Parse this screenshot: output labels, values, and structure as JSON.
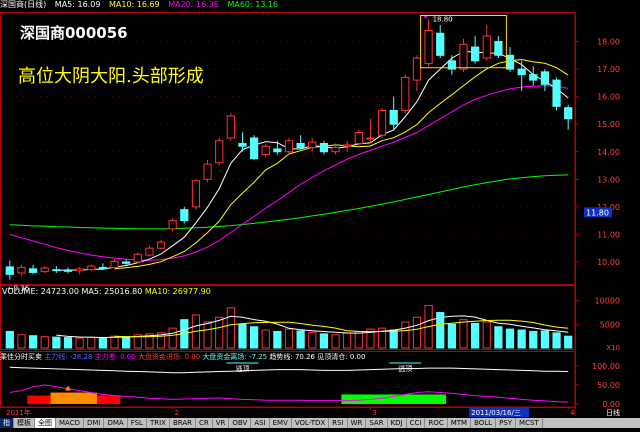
{
  "header": {
    "title": "深国商(日线)",
    "ma": [
      {
        "label": "MA5: 16.09",
        "color": "#ffffff"
      },
      {
        "label": "MA10: 16.69",
        "color": "#ffff00"
      },
      {
        "label": "MA20: 16.36",
        "color": "#ff00ff"
      },
      {
        "label": "MA60: 13.16",
        "color": "#00ff00"
      }
    ]
  },
  "stock_label": "深国商000056",
  "annotation": "高位大阴大阳.头部形成",
  "colors": {
    "up": "#ff3232",
    "down": "#54ffff",
    "ma5": "#ffffff",
    "ma10": "#ffff00",
    "ma20": "#ff00ff",
    "ma60": "#00ff00",
    "axis": "#b40000",
    "annotation": "#ffff00"
  },
  "price_axis": {
    "ticks": [
      "18.00",
      "17.00",
      "16.00",
      "15.00",
      "14.00",
      "13.00",
      "12.00",
      "11.00",
      "10.00"
    ],
    "last": "11.80"
  },
  "price_markers": {
    "high": "18.80",
    "low": "9.36"
  },
  "volume_header": {
    "label": "VOLUME: 24723.00",
    "ma5": "MA5: 25016.80",
    "ma10": "MA10: 26977.90"
  },
  "volume_axis": {
    "ticks": [
      "10000",
      "5000"
    ],
    "unit": "X10"
  },
  "indicator_header": {
    "title": "乘佳分时买卖",
    "items": [
      {
        "label": "主力线:  -28.28",
        "color": "#4a6bff"
      },
      {
        "label": "主力差: 0.00",
        "color": "#ff00ff"
      },
      {
        "label": "大盘资金进场: 0.00",
        "color": "#ff3232"
      },
      {
        "label": "大盘资金离场: -7.25",
        "color": "#54ffff"
      },
      {
        "label": "趋势线: 70.26",
        "color": "#ffffff"
      },
      {
        "label": "见顶清仓: 0.00",
        "color": "#ffffff"
      }
    ]
  },
  "indicator_axis": {
    "ticks": [
      "100.00",
      "50.00",
      "0.00"
    ]
  },
  "indicator_notes": [
    "逃顶",
    "逃顶"
  ],
  "x_axis": {
    "labels": [
      "2011年",
      "2",
      "3",
      "4"
    ],
    "date_box": "2011/03/16/三",
    "right": "日线"
  },
  "tabs": [
    "指",
    "模板",
    "全图",
    "MACD",
    "DMI",
    "DMA",
    "FSL",
    "TRIX",
    "BRAR",
    "CR",
    "VR",
    "OBV",
    "ASI",
    "EMV",
    "VOL-TDX",
    "RSI",
    "WR",
    "SAR",
    "KDJ",
    "CCI",
    "ROC",
    "MTM",
    "BOLL",
    "PSY",
    "MCST"
  ],
  "chart_data": {
    "type": "candlestick",
    "ylim": [
      9.2,
      19.0
    ],
    "candles": [
      {
        "o": 9.82,
        "h": 10.05,
        "l": 9.36,
        "c": 9.55
      },
      {
        "o": 9.6,
        "h": 9.9,
        "l": 9.5,
        "c": 9.8
      },
      {
        "o": 9.75,
        "h": 9.9,
        "l": 9.55,
        "c": 9.62
      },
      {
        "o": 9.65,
        "h": 9.85,
        "l": 9.6,
        "c": 9.78
      },
      {
        "o": 9.72,
        "h": 9.85,
        "l": 9.6,
        "c": 9.7
      },
      {
        "o": 9.7,
        "h": 9.8,
        "l": 9.58,
        "c": 9.66
      },
      {
        "o": 9.68,
        "h": 9.82,
        "l": 9.55,
        "c": 9.75
      },
      {
        "o": 9.72,
        "h": 9.9,
        "l": 9.65,
        "c": 9.85
      },
      {
        "o": 9.8,
        "h": 9.95,
        "l": 9.7,
        "c": 9.76
      },
      {
        "o": 9.8,
        "h": 10.1,
        "l": 9.72,
        "c": 10.02
      },
      {
        "o": 10.0,
        "h": 10.1,
        "l": 9.9,
        "c": 9.95
      },
      {
        "o": 10.0,
        "h": 10.35,
        "l": 9.95,
        "c": 10.28
      },
      {
        "o": 10.25,
        "h": 10.6,
        "l": 10.2,
        "c": 10.5
      },
      {
        "o": 10.5,
        "h": 10.8,
        "l": 10.45,
        "c": 10.72
      },
      {
        "o": 11.2,
        "h": 11.6,
        "l": 11.1,
        "c": 11.5
      },
      {
        "o": 11.9,
        "h": 12.0,
        "l": 11.4,
        "c": 11.5
      },
      {
        "o": 12.0,
        "h": 13.0,
        "l": 11.9,
        "c": 12.95
      },
      {
        "o": 13.0,
        "h": 13.7,
        "l": 12.9,
        "c": 13.55
      },
      {
        "o": 13.6,
        "h": 14.5,
        "l": 13.5,
        "c": 14.4
      },
      {
        "o": 14.5,
        "h": 15.4,
        "l": 14.4,
        "c": 15.3
      },
      {
        "o": 14.3,
        "h": 14.7,
        "l": 14.0,
        "c": 14.2
      },
      {
        "o": 14.5,
        "h": 14.6,
        "l": 13.7,
        "c": 13.75
      },
      {
        "o": 13.9,
        "h": 14.3,
        "l": 13.8,
        "c": 14.2
      },
      {
        "o": 14.1,
        "h": 14.4,
        "l": 13.9,
        "c": 14.0
      },
      {
        "o": 14.0,
        "h": 14.5,
        "l": 13.9,
        "c": 14.4
      },
      {
        "o": 14.3,
        "h": 14.6,
        "l": 14.1,
        "c": 14.15
      },
      {
        "o": 14.15,
        "h": 14.5,
        "l": 14.0,
        "c": 14.35
      },
      {
        "o": 14.3,
        "h": 14.4,
        "l": 13.9,
        "c": 14.0
      },
      {
        "o": 14.0,
        "h": 14.3,
        "l": 13.9,
        "c": 14.15
      },
      {
        "o": 14.2,
        "h": 14.4,
        "l": 14.0,
        "c": 14.25
      },
      {
        "o": 14.3,
        "h": 14.8,
        "l": 14.2,
        "c": 14.7
      },
      {
        "o": 14.5,
        "h": 15.2,
        "l": 14.3,
        "c": 14.5
      },
      {
        "o": 14.6,
        "h": 15.6,
        "l": 14.5,
        "c": 15.5
      },
      {
        "o": 15.5,
        "h": 16.0,
        "l": 14.8,
        "c": 15.0
      },
      {
        "o": 15.5,
        "h": 16.8,
        "l": 15.4,
        "c": 16.7
      },
      {
        "o": 16.6,
        "h": 17.5,
        "l": 16.2,
        "c": 17.4
      },
      {
        "o": 17.2,
        "h": 18.8,
        "l": 17.1,
        "c": 18.4
      },
      {
        "o": 18.3,
        "h": 18.6,
        "l": 17.4,
        "c": 17.5
      },
      {
        "o": 17.3,
        "h": 17.5,
        "l": 16.8,
        "c": 17.0
      },
      {
        "o": 17.0,
        "h": 18.1,
        "l": 16.9,
        "c": 17.9
      },
      {
        "o": 17.8,
        "h": 18.2,
        "l": 17.2,
        "c": 17.3
      },
      {
        "o": 17.4,
        "h": 18.6,
        "l": 17.3,
        "c": 18.2
      },
      {
        "o": 18.0,
        "h": 18.2,
        "l": 17.4,
        "c": 17.5
      },
      {
        "o": 17.5,
        "h": 17.8,
        "l": 16.9,
        "c": 17.0
      },
      {
        "o": 17.0,
        "h": 17.3,
        "l": 16.2,
        "c": 16.8
      },
      {
        "o": 16.8,
        "h": 17.1,
        "l": 16.4,
        "c": 16.6
      },
      {
        "o": 16.9,
        "h": 17.0,
        "l": 16.2,
        "c": 16.45
      },
      {
        "o": 16.6,
        "h": 16.7,
        "l": 15.5,
        "c": 15.65
      },
      {
        "o": 15.6,
        "h": 15.7,
        "l": 14.8,
        "c": 15.2
      }
    ],
    "ma5": [
      null,
      null,
      null,
      null,
      9.69,
      9.71,
      9.7,
      9.73,
      9.74,
      9.81,
      9.87,
      9.97,
      10.1,
      10.29,
      10.59,
      10.9,
      11.42,
      11.99,
      12.66,
      13.58,
      14.08,
      14.24,
      14.37,
      14.33,
      14.11,
      14.1,
      14.22,
      14.18,
      14.13,
      14.18,
      14.29,
      14.32,
      14.62,
      14.79,
      15.28,
      15.82,
      16.6,
      17.0,
      17.4,
      17.64,
      17.62,
      17.58,
      17.58,
      17.38,
      17.16,
      16.8,
      16.55,
      16.3,
      15.95
    ],
    "ma10": [
      null,
      null,
      null,
      null,
      null,
      null,
      null,
      null,
      null,
      9.75,
      9.79,
      9.84,
      9.91,
      10.01,
      10.19,
      10.38,
      10.69,
      11.07,
      11.48,
      12.08,
      12.5,
      12.89,
      13.34,
      13.58,
      13.92,
      14.04,
      14.16,
      14.2,
      14.25,
      14.22,
      14.18,
      14.21,
      14.4,
      14.51,
      14.72,
      14.99,
      15.42,
      15.75,
      16.07,
      16.4,
      16.72,
      17.01,
      17.21,
      17.3,
      17.35,
      17.26,
      17.21,
      17.05,
      16.78
    ],
    "ma20": [
      11.0,
      10.88,
      10.76,
      10.64,
      10.52,
      10.42,
      10.33,
      10.25,
      10.19,
      10.14,
      10.1,
      10.07,
      10.06,
      10.08,
      10.14,
      10.22,
      10.36,
      10.54,
      10.77,
      11.07,
      11.37,
      11.65,
      11.95,
      12.23,
      12.53,
      12.82,
      13.07,
      13.31,
      13.52,
      13.73,
      13.9,
      14.05,
      14.2,
      14.35,
      14.52,
      14.7,
      14.95,
      15.2,
      15.45,
      15.7,
      15.9,
      16.05,
      16.18,
      16.28,
      16.35,
      16.38,
      16.4,
      16.38,
      16.3
    ],
    "ma60": [
      11.35,
      11.33,
      11.31,
      11.3,
      11.28,
      11.27,
      11.25,
      11.24,
      11.23,
      11.22,
      11.21,
      11.2,
      11.2,
      11.2,
      11.21,
      11.22,
      11.24,
      11.26,
      11.29,
      11.32,
      11.36,
      11.4,
      11.45,
      11.5,
      11.55,
      11.61,
      11.67,
      11.73,
      11.8,
      11.87,
      11.94,
      12.02,
      12.1,
      12.18,
      12.27,
      12.36,
      12.45,
      12.54,
      12.63,
      12.72,
      12.8,
      12.88,
      12.95,
      13.01,
      13.06,
      13.1,
      13.13,
      13.15,
      13.16
    ],
    "volume": [
      3500,
      2800,
      2600,
      2400,
      2300,
      2200,
      2100,
      2300,
      2200,
      2500,
      2400,
      2800,
      3000,
      3200,
      4200,
      6000,
      7000,
      5500,
      6500,
      8500,
      5000,
      4500,
      3800,
      3500,
      4000,
      3600,
      3300,
      3000,
      2800,
      3200,
      3500,
      4000,
      4200,
      3800,
      5500,
      6500,
      9000,
      7500,
      5000,
      6000,
      5200,
      5500,
      4500,
      4000,
      3800,
      3500,
      3600,
      3200,
      2500
    ],
    "indicator": {
      "trend": [
        96,
        95,
        94,
        93,
        92,
        91,
        90,
        89,
        88,
        87,
        86,
        85,
        84,
        83,
        82,
        82,
        83,
        84,
        85,
        86,
        87,
        88,
        89,
        90,
        90,
        90,
        89,
        88,
        88,
        88,
        89,
        90,
        91,
        92,
        93,
        93,
        94,
        94,
        94,
        93,
        92,
        91,
        90,
        89,
        88,
        87,
        86,
        86,
        85
      ],
      "main": [
        30,
        35,
        45,
        50,
        45,
        40,
        35,
        30,
        25,
        22,
        20,
        18,
        15,
        14,
        12,
        13,
        14,
        15,
        16,
        14,
        12,
        11,
        10,
        10,
        10,
        10,
        9,
        9,
        9,
        9,
        10,
        12,
        15,
        20,
        25,
        30,
        32,
        30,
        28,
        25,
        22,
        20,
        18,
        15,
        12,
        10,
        8,
        6,
        5
      ],
      "bands": [
        {
          "from": 2,
          "to": 9,
          "value": 22,
          "color": "#ff0000"
        },
        {
          "from": 4,
          "to": 7,
          "value": 30,
          "color": "#ff8c00"
        },
        {
          "from": 29,
          "to": 37,
          "value": 25,
          "color": "#00ff00"
        }
      ],
      "ylim": [
        0,
        110
      ]
    }
  }
}
